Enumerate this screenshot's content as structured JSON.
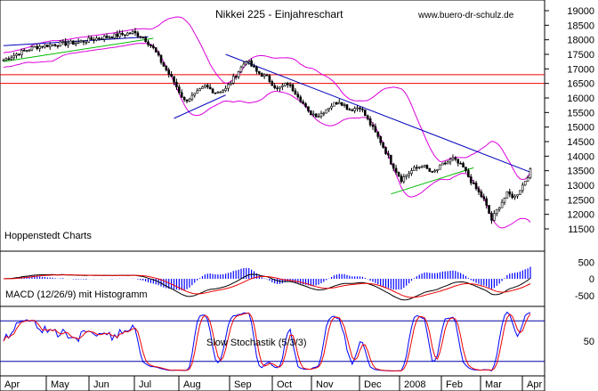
{
  "chart_data": {
    "type": "candlestick",
    "title": "Nikkei 225 - Einjahreschart",
    "source_url": "www.buero-dr-schulz.de",
    "watermark": "Hoppenstedt Charts",
    "months": [
      "Apr",
      "May",
      "Jun",
      "Jul",
      "Aug",
      "Sep",
      "Oct",
      "Nov",
      "Dec",
      "2008",
      "Feb",
      "Mar",
      "Apr"
    ],
    "y_ticks": [
      11500,
      12000,
      12500,
      13000,
      13500,
      14000,
      14500,
      15000,
      15500,
      16000,
      16500,
      17000,
      17500,
      18000,
      18500,
      19000
    ],
    "ylim": [
      11500,
      19000
    ],
    "horizontal_lines": [
      16500,
      16800
    ],
    "price_anchors": [
      {
        "t": 0,
        "v": 17300
      },
      {
        "t": 6,
        "v": 17550
      },
      {
        "t": 12,
        "v": 17750
      },
      {
        "t": 20,
        "v": 17850
      },
      {
        "t": 28,
        "v": 17900
      },
      {
        "t": 36,
        "v": 18050
      },
      {
        "t": 44,
        "v": 18150
      },
      {
        "t": 50,
        "v": 18250
      },
      {
        "t": 54,
        "v": 18100
      },
      {
        "t": 58,
        "v": 17700
      },
      {
        "t": 62,
        "v": 17100
      },
      {
        "t": 66,
        "v": 16550
      },
      {
        "t": 70,
        "v": 15900
      },
      {
        "t": 74,
        "v": 16100
      },
      {
        "t": 78,
        "v": 16400
      },
      {
        "t": 82,
        "v": 16200
      },
      {
        "t": 86,
        "v": 16300
      },
      {
        "t": 90,
        "v": 16800
      },
      {
        "t": 94,
        "v": 17300
      },
      {
        "t": 98,
        "v": 16900
      },
      {
        "t": 102,
        "v": 16700
      },
      {
        "t": 106,
        "v": 16300
      },
      {
        "t": 110,
        "v": 16500
      },
      {
        "t": 114,
        "v": 16100
      },
      {
        "t": 118,
        "v": 15500
      },
      {
        "t": 122,
        "v": 15400
      },
      {
        "t": 126,
        "v": 15700
      },
      {
        "t": 130,
        "v": 15900
      },
      {
        "t": 134,
        "v": 15600
      },
      {
        "t": 138,
        "v": 15700
      },
      {
        "t": 142,
        "v": 15100
      },
      {
        "t": 146,
        "v": 14500
      },
      {
        "t": 150,
        "v": 13800
      },
      {
        "t": 154,
        "v": 13200
      },
      {
        "t": 158,
        "v": 13500
      },
      {
        "t": 162,
        "v": 13700
      },
      {
        "t": 166,
        "v": 13400
      },
      {
        "t": 170,
        "v": 13700
      },
      {
        "t": 174,
        "v": 13900
      },
      {
        "t": 178,
        "v": 13600
      },
      {
        "t": 182,
        "v": 13000
      },
      {
        "t": 186,
        "v": 12500
      },
      {
        "t": 189,
        "v": 11800
      },
      {
        "t": 192,
        "v": 12300
      },
      {
        "t": 195,
        "v": 12700
      },
      {
        "t": 198,
        "v": 12600
      },
      {
        "t": 201,
        "v": 13000
      },
      {
        "t": 204,
        "v": 13500
      }
    ],
    "trendlines": [
      {
        "name": "blue-upper",
        "t0": 0,
        "v0": 17800,
        "t1": 56,
        "v1": 18100
      },
      {
        "name": "green-upper",
        "t0": 0,
        "v0": 17250,
        "t1": 58,
        "v1": 18050
      },
      {
        "name": "blue-aug",
        "t0": 66,
        "v0": 15300,
        "t1": 86,
        "v1": 16100
      },
      {
        "name": "blue-down",
        "t0": 86,
        "v0": 17500,
        "t1": 204,
        "v1": 13450
      },
      {
        "name": "green-feb",
        "t0": 150,
        "v0": 12700,
        "t1": 182,
        "v1": 13600
      }
    ],
    "macd_ticks": [
      -500,
      0,
      500
    ],
    "macd_ylim": [
      -800,
      800
    ],
    "macd_label": "MACD (12/26/9) mit Histogramm",
    "stoch_ticks": [
      50
    ],
    "stoch_levels": [
      20,
      80
    ],
    "stoch_label": "Slow Stochastik (5/3/3)",
    "colors": {
      "candle": "#000000",
      "bollinger": "#dd00dd",
      "resistance": "#ee0000",
      "trend_blue": "#0000bb",
      "trend_green": "#00bb00",
      "macd_hist": "#0000ff",
      "macd_line": "#000000",
      "signal_line": "#ee0000",
      "stoch_k": "#0000ff",
      "stoch_d": "#ee0000",
      "stoch_levels": "#0000aa"
    }
  }
}
